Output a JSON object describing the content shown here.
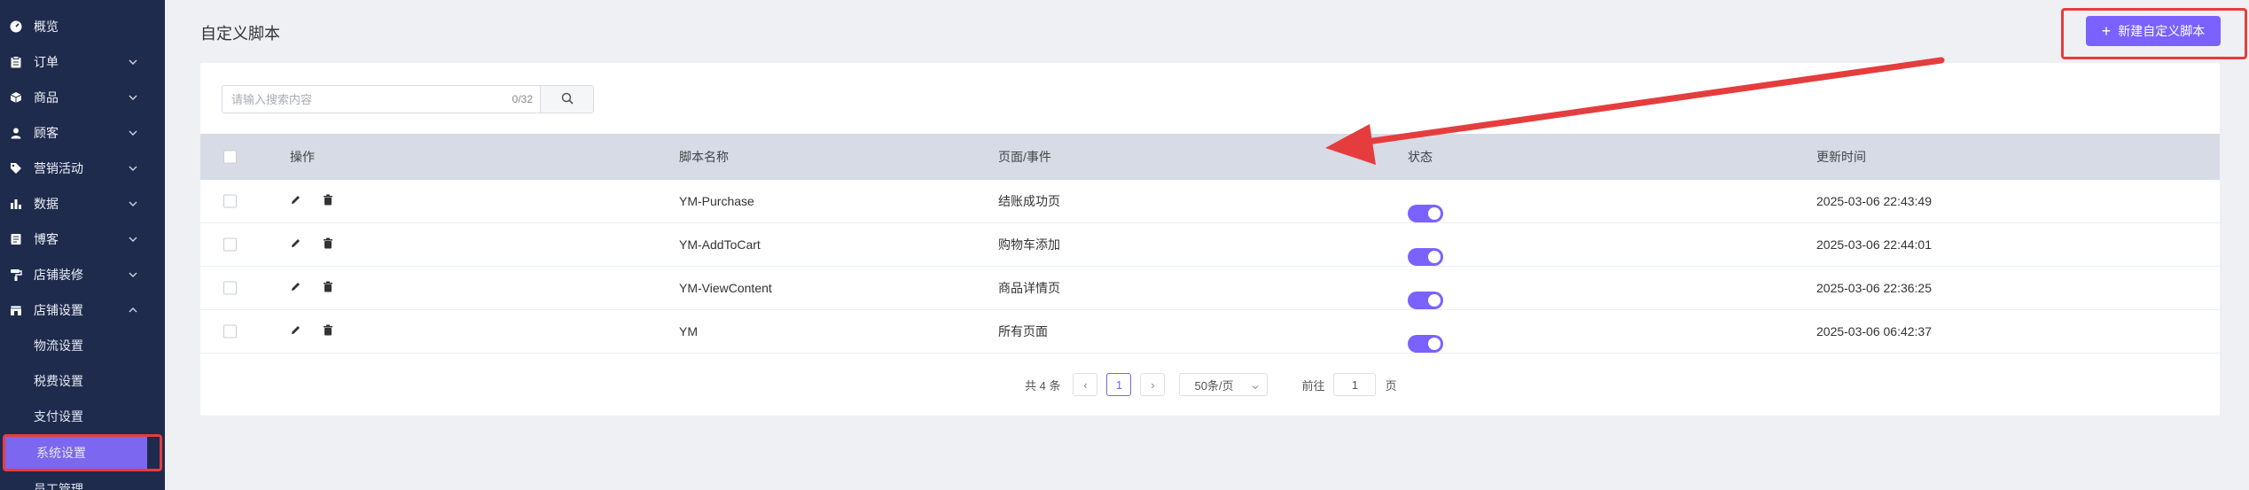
{
  "sidebar": {
    "items": [
      {
        "label": "概览",
        "icon": "dashboard-icon",
        "expandable": false
      },
      {
        "label": "订单",
        "icon": "clipboard-icon",
        "expandable": true
      },
      {
        "label": "商品",
        "icon": "box-icon",
        "expandable": true
      },
      {
        "label": "顾客",
        "icon": "user-icon",
        "expandable": true
      },
      {
        "label": "营销活动",
        "icon": "tag-icon",
        "expandable": true
      },
      {
        "label": "数据",
        "icon": "bar-chart-icon",
        "expandable": true
      },
      {
        "label": "博客",
        "icon": "document-icon",
        "expandable": true
      },
      {
        "label": "店铺装修",
        "icon": "paint-roller-icon",
        "expandable": true
      },
      {
        "label": "店铺设置",
        "icon": "store-icon",
        "expandable": true,
        "expanded": true
      }
    ],
    "subitems": [
      {
        "label": "物流设置"
      },
      {
        "label": "税费设置"
      },
      {
        "label": "支付设置"
      },
      {
        "label": "系统设置",
        "active": true
      },
      {
        "label": "员工管理"
      }
    ]
  },
  "header": {
    "title": "自定义脚本",
    "new_button_label": "新建自定义脚本"
  },
  "search": {
    "placeholder": "请输入搜索内容",
    "count": "0/32"
  },
  "table": {
    "columns": {
      "ops": "操作",
      "name": "脚本名称",
      "page": "页面/事件",
      "status": "状态",
      "time": "更新时间"
    },
    "rows": [
      {
        "name": "YM-Purchase",
        "page": "结账成功页",
        "enabled": true,
        "time": "2025-03-06 22:43:49"
      },
      {
        "name": "YM-AddToCart",
        "page": "购物车添加",
        "enabled": true,
        "time": "2025-03-06 22:44:01"
      },
      {
        "name": "YM-ViewContent",
        "page": "商品详情页",
        "enabled": true,
        "time": "2025-03-06 22:36:25"
      },
      {
        "name": "YM",
        "page": "所有页面",
        "enabled": true,
        "time": "2025-03-06 06:42:37"
      }
    ]
  },
  "pagination": {
    "total": "共 4 条",
    "current_page": "1",
    "page_size": "50条/页",
    "goto_label": "前往",
    "goto_value": "1",
    "page_suffix": "页"
  },
  "colors": {
    "sidebar_bg": "#1f2b4d",
    "accent": "#7b61ff",
    "highlight_red": "#e53d3d"
  }
}
